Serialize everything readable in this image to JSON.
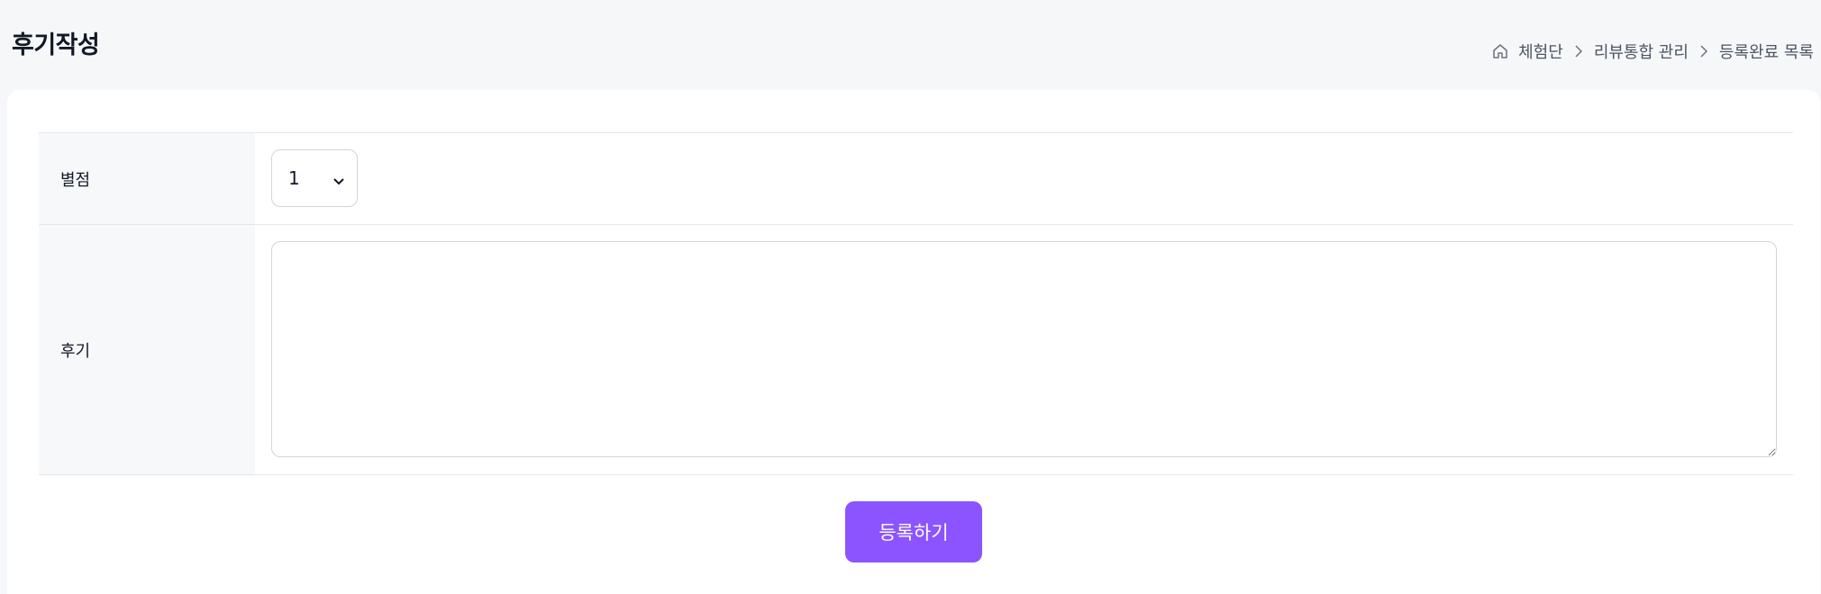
{
  "page": {
    "title": "후기작성"
  },
  "breadcrumb": {
    "items": [
      "체험단",
      "리뷰통합 관리",
      "등록완료 목록"
    ]
  },
  "form": {
    "rating": {
      "label": "별점",
      "selected": "1"
    },
    "review": {
      "label": "후기",
      "value": ""
    },
    "submit_label": "등록하기"
  },
  "colors": {
    "accent": "#8b54ff",
    "label_bg": "#f7f8fa",
    "page_bg": "#f6f7f9"
  },
  "icons": {
    "home": "home-icon",
    "separator": "chevron-right-icon",
    "select": "chevron-down-icon"
  }
}
